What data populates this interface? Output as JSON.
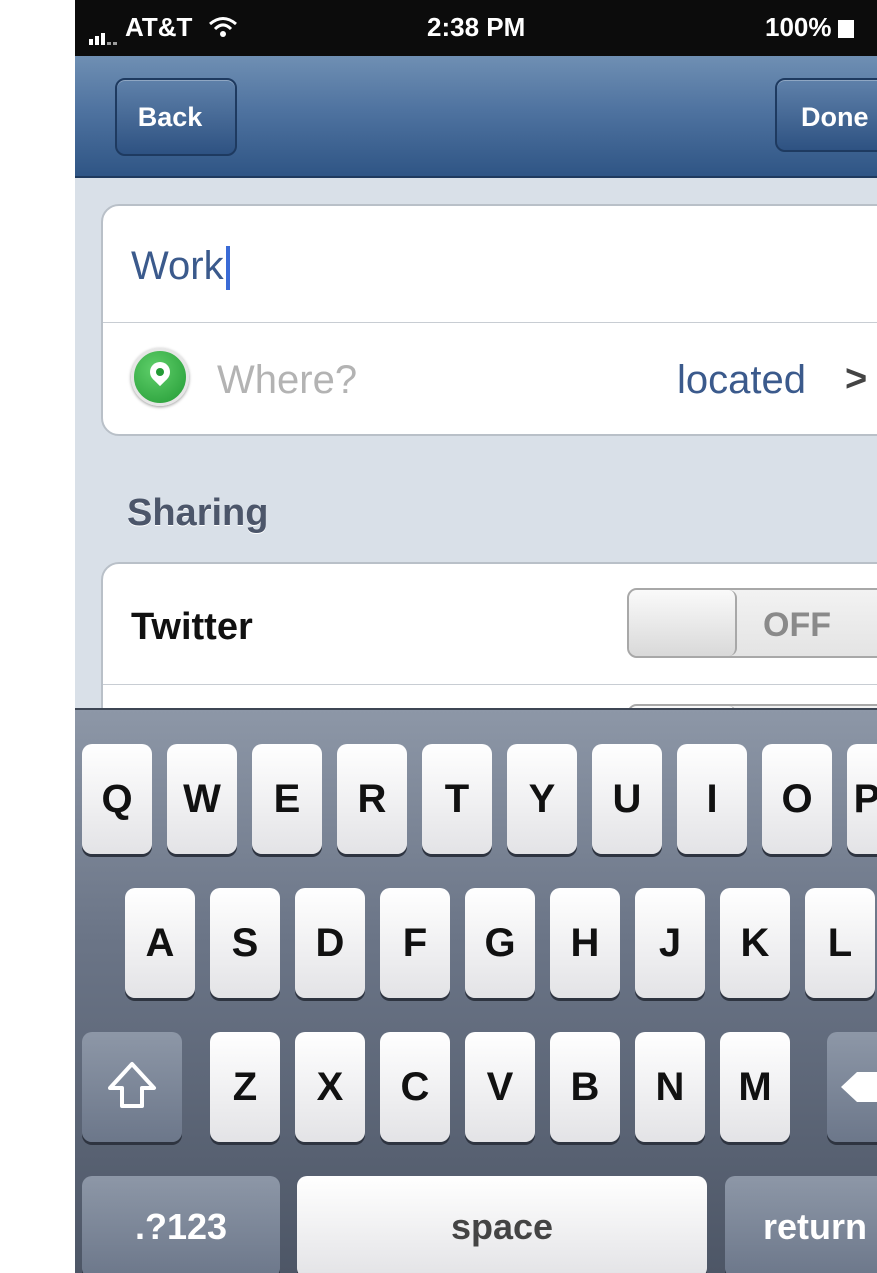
{
  "status": {
    "carrier": "AT&T",
    "time": "2:38 PM",
    "battery": "100%"
  },
  "nav": {
    "back_label": "Back",
    "done_label": "Done"
  },
  "form": {
    "name_value": "Work",
    "where_placeholder": "Where?",
    "location_status": "located",
    "chevron": ">"
  },
  "sharing": {
    "header": "Sharing",
    "twitter_label": "Twitter",
    "twitter_state": "OFF"
  },
  "keyboard": {
    "row1": [
      "Q",
      "W",
      "E",
      "R",
      "T",
      "Y",
      "U",
      "I",
      "O",
      "P"
    ],
    "row2": [
      "A",
      "S",
      "D",
      "F",
      "G",
      "H",
      "J",
      "K",
      "L"
    ],
    "row3": [
      "Z",
      "X",
      "C",
      "V",
      "B",
      "N",
      "M"
    ],
    "numbers_label": ".?123",
    "space_label": "space",
    "return_label": "return"
  },
  "icons": {
    "location": "location-pin-icon",
    "shift": "shift-arrow-icon",
    "delete": "delete-icon",
    "wifi": "wifi-icon",
    "signal": "signal-bars-icon",
    "battery": "battery-icon"
  }
}
